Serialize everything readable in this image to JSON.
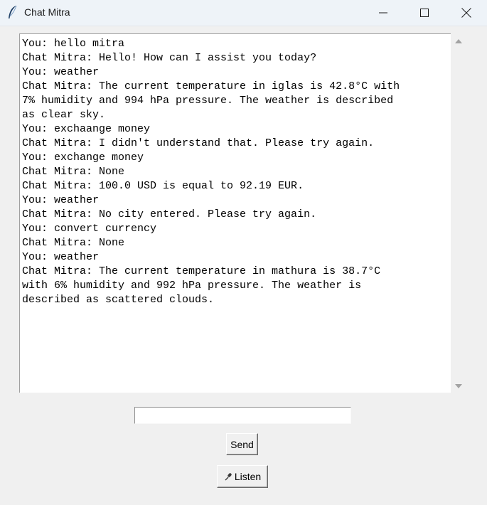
{
  "window": {
    "title": "Chat Mitra",
    "app_icon": "feather-icon",
    "controls": [
      "minimize-icon",
      "maximize-icon",
      "close-icon"
    ]
  },
  "chat": {
    "lines": [
      "You: hello mitra",
      "Chat Mitra: Hello! How can I assist you today?",
      "You: weather",
      "Chat Mitra: The current temperature in iglas is 42.8°C with",
      "7% humidity and 994 hPa pressure. The weather is described",
      "as clear sky.",
      "You: exchaange money",
      "Chat Mitra: I didn't understand that. Please try again.",
      "You: exchange money",
      "Chat Mitra: None",
      "Chat Mitra: 100.0 USD is equal to 92.19 EUR.",
      "You: weather",
      "Chat Mitra: No city entered. Please try again.",
      "You: convert currency",
      "Chat Mitra: None",
      "You: weather",
      "Chat Mitra: The current temperature in mathura is 38.7°C",
      "with 6% humidity and 992 hPa pressure. The weather is",
      "described as scattered clouds."
    ]
  },
  "input": {
    "value": ""
  },
  "buttons": {
    "send_label": "Send",
    "listen_label": "Listen",
    "listen_icon": "microphone-icon"
  }
}
